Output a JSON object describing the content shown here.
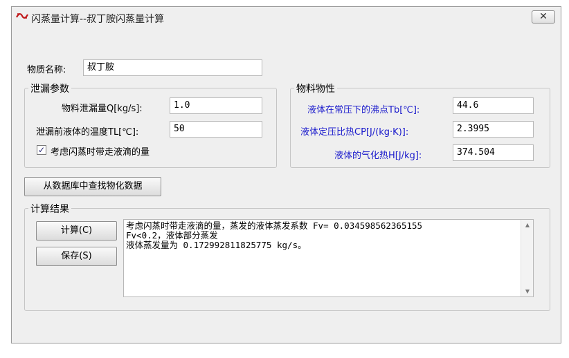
{
  "window": {
    "title": "闪蒸量计算--叔丁胺闪蒸量计算",
    "close_symbol": "✕"
  },
  "substance": {
    "label": "物质名称:",
    "value": "叔丁胺"
  },
  "leak": {
    "group_title": "泄漏参数",
    "rate_label": "物料泄漏量Q[kg/s]:",
    "rate_value": "1.0",
    "temp_label": "泄漏前液体的温度TL[℃]:",
    "temp_value": "50",
    "droplet_checkbox": {
      "label": "考虑闪蒸时带走液滴的量",
      "checked": true,
      "mark": "✓"
    }
  },
  "props": {
    "group_title": "物料物性",
    "boiling_label": "液体在常压下的沸点Tb[℃]:",
    "boiling_value": "44.6",
    "cp_label": "液体定压比热CP[J/(kg·K)]:",
    "cp_value": "2.3995",
    "heat_label": "液体的气化热H[J/kg]:",
    "heat_value": "374.504"
  },
  "db_button": "从数据库中查找物化数据",
  "results": {
    "group_title": "计算结果",
    "calc_button": "计算(C)",
    "save_button": "保存(S)",
    "text": "考虑闪蒸时带走液滴的量，蒸发的液体蒸发系数 Fv= 0.034598562365155\nFv<0.2，液体部分蒸发\n液体蒸发量为 0.172992811825775 kg/s。"
  },
  "colors": {
    "window_bg": "#efefef",
    "blue_label": "#1a1acc",
    "border": "#c5c5c5"
  },
  "icons": {
    "app": "app-logo-icon",
    "close": "close-icon",
    "scroll_up": "scroll-up-icon",
    "scroll_down": "scroll-down-icon"
  }
}
